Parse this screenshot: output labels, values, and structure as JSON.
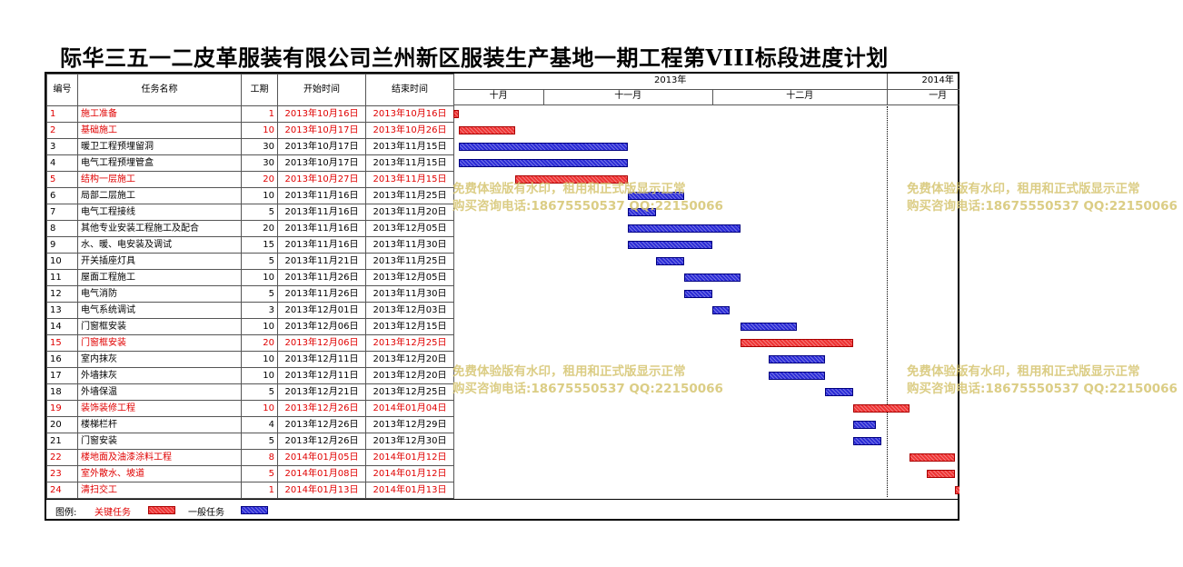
{
  "title": "际华三五一二皮革服装有限公司兰州新区服装生产基地一期工程第VIII标段进度计划",
  "columns": {
    "no": "编号",
    "name": "任务名称",
    "duration": "工期",
    "start": "开始时间",
    "end": "结束时间"
  },
  "timeline": {
    "years": [
      {
        "label": "2013年",
        "start": "2013-10-16",
        "end": "2013-12-31"
      },
      {
        "label": "2014年",
        "start": "2014-01-01",
        "end": "2014-01-18"
      }
    ],
    "months": [
      {
        "label": "十月",
        "start": "2013-10-16",
        "end": "2013-10-31"
      },
      {
        "label": "十一月",
        "start": "2013-11-01",
        "end": "2013-11-30"
      },
      {
        "label": "十二月",
        "start": "2013-12-01",
        "end": "2013-12-31"
      },
      {
        "label": "一月",
        "start": "2014-01-01",
        "end": "2014-01-18"
      }
    ]
  },
  "tasks": [
    {
      "no": "1",
      "name": "施工准备",
      "duration": "1",
      "start": "2013年10月16日",
      "end": "2013年10月16日",
      "s": "2013-10-16",
      "e": "2013-10-16",
      "critical": true
    },
    {
      "no": "2",
      "name": "基础施工",
      "duration": "10",
      "start": "2013年10月17日",
      "end": "2013年10月26日",
      "s": "2013-10-17",
      "e": "2013-10-26",
      "critical": true
    },
    {
      "no": "3",
      "name": "暖卫工程预埋留洞",
      "duration": "30",
      "start": "2013年10月17日",
      "end": "2013年11月15日",
      "s": "2013-10-17",
      "e": "2013-11-15",
      "critical": false
    },
    {
      "no": "4",
      "name": "电气工程预埋管盒",
      "duration": "30",
      "start": "2013年10月17日",
      "end": "2013年11月15日",
      "s": "2013-10-17",
      "e": "2013-11-15",
      "critical": false
    },
    {
      "no": "5",
      "name": "结构一层施工",
      "duration": "20",
      "start": "2013年10月27日",
      "end": "2013年11月15日",
      "s": "2013-10-27",
      "e": "2013-11-15",
      "critical": true
    },
    {
      "no": "6",
      "name": "局部二层施工",
      "duration": "10",
      "start": "2013年11月16日",
      "end": "2013年11月25日",
      "s": "2013-11-16",
      "e": "2013-11-25",
      "critical": false
    },
    {
      "no": "7",
      "name": "电气工程接线",
      "duration": "5",
      "start": "2013年11月16日",
      "end": "2013年11月20日",
      "s": "2013-11-16",
      "e": "2013-11-20",
      "critical": false
    },
    {
      "no": "8",
      "name": "其他专业安装工程施工及配合",
      "duration": "20",
      "start": "2013年11月16日",
      "end": "2013年12月05日",
      "s": "2013-11-16",
      "e": "2013-12-05",
      "critical": false
    },
    {
      "no": "9",
      "name": "水、暖、电安装及调试",
      "duration": "15",
      "start": "2013年11月16日",
      "end": "2013年11月30日",
      "s": "2013-11-16",
      "e": "2013-11-30",
      "critical": false
    },
    {
      "no": "10",
      "name": "开关插座灯具",
      "duration": "5",
      "start": "2013年11月21日",
      "end": "2013年11月25日",
      "s": "2013-11-21",
      "e": "2013-11-25",
      "critical": false
    },
    {
      "no": "11",
      "name": "屋面工程施工",
      "duration": "10",
      "start": "2013年11月26日",
      "end": "2013年12月05日",
      "s": "2013-11-26",
      "e": "2013-12-05",
      "critical": false
    },
    {
      "no": "12",
      "name": "电气消防",
      "duration": "5",
      "start": "2013年11月26日",
      "end": "2013年11月30日",
      "s": "2013-11-26",
      "e": "2013-11-30",
      "critical": false
    },
    {
      "no": "13",
      "name": "电气系统调试",
      "duration": "3",
      "start": "2013年12月01日",
      "end": "2013年12月03日",
      "s": "2013-12-01",
      "e": "2013-12-03",
      "critical": false
    },
    {
      "no": "14",
      "name": "门窗框安装",
      "duration": "10",
      "start": "2013年12月06日",
      "end": "2013年12月15日",
      "s": "2013-12-06",
      "e": "2013-12-15",
      "critical": false
    },
    {
      "no": "15",
      "name": "门窗框安装",
      "duration": "20",
      "start": "2013年12月06日",
      "end": "2013年12月25日",
      "s": "2013-12-06",
      "e": "2013-12-25",
      "critical": true
    },
    {
      "no": "16",
      "name": "室内抹灰",
      "duration": "10",
      "start": "2013年12月11日",
      "end": "2013年12月20日",
      "s": "2013-12-11",
      "e": "2013-12-20",
      "critical": false
    },
    {
      "no": "17",
      "name": "外墙抹灰",
      "duration": "10",
      "start": "2013年12月11日",
      "end": "2013年12月20日",
      "s": "2013-12-11",
      "e": "2013-12-20",
      "critical": false
    },
    {
      "no": "18",
      "name": "外墙保温",
      "duration": "5",
      "start": "2013年12月21日",
      "end": "2013年12月25日",
      "s": "2013-12-21",
      "e": "2013-12-25",
      "critical": false
    },
    {
      "no": "19",
      "name": "装饰装修工程",
      "duration": "10",
      "start": "2013年12月26日",
      "end": "2014年01月04日",
      "s": "2013-12-26",
      "e": "2014-01-04",
      "critical": true
    },
    {
      "no": "20",
      "name": "楼梯栏杆",
      "duration": "4",
      "start": "2013年12月26日",
      "end": "2013年12月29日",
      "s": "2013-12-26",
      "e": "2013-12-29",
      "critical": false
    },
    {
      "no": "21",
      "name": "门窗安装",
      "duration": "5",
      "start": "2013年12月26日",
      "end": "2013年12月30日",
      "s": "2013-12-26",
      "e": "2013-12-30",
      "critical": false
    },
    {
      "no": "22",
      "name": "楼地面及油漆涂料工程",
      "duration": "8",
      "start": "2014年01月05日",
      "end": "2014年01月12日",
      "s": "2014-01-05",
      "e": "2014-01-12",
      "critical": true
    },
    {
      "no": "23",
      "name": "室外散水、坡道",
      "duration": "5",
      "start": "2014年01月08日",
      "end": "2014年01月12日",
      "s": "2014-01-08",
      "e": "2014-01-12",
      "critical": true
    },
    {
      "no": "24",
      "name": "清扫交工",
      "duration": "1",
      "start": "2014年01月13日",
      "end": "2014年01月13日",
      "s": "2014-01-13",
      "e": "2014-01-13",
      "critical": true
    }
  ],
  "watermark": {
    "line1": "免费体验版有水印，租用和正式版显示正常",
    "line2": "购买咨询电话:18675550537 QQ:22150066"
  },
  "legend": {
    "label": "图例:",
    "critical": "关键任务",
    "normal": "一般任务"
  },
  "colors": {
    "critical": "#e33333",
    "normal": "#2b2bd6",
    "critical_text": "#e00000",
    "watermark": "#d8c878"
  }
}
